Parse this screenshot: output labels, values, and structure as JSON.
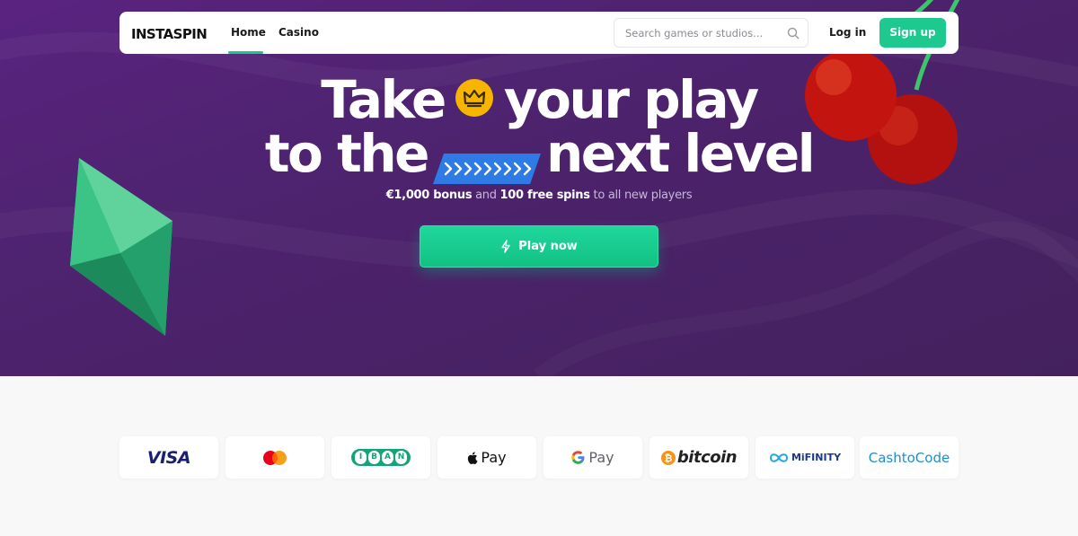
{
  "header": {
    "logo_text": "INSTASPIN",
    "nav": [
      {
        "label": "Home",
        "active": true
      },
      {
        "label": "Casino",
        "active": false
      }
    ],
    "search_placeholder": "Search games or studios...",
    "login_label": "Log in",
    "signup_label": "Sign up"
  },
  "hero": {
    "line1_word1": "Take",
    "line1_word2": "your play",
    "line2_word1": "to the",
    "line2_word2": "next level",
    "bonus_amount": "€1,000 bonus",
    "and_text": "and",
    "free_spins": "100 free spins",
    "to_players": "to all new players",
    "play_button_label": "Play now"
  },
  "payments": {
    "methods": [
      "VISA",
      "Mastercard",
      "IBAN",
      "Apple Pay",
      "Google Pay",
      "bitcoin",
      "MiFINITY",
      "CashtoCode"
    ],
    "visa_text": "VISA",
    "iban_letters": [
      "I",
      "B",
      "A",
      "N"
    ],
    "applepay_text": "Pay",
    "gpay_text": "Pay",
    "bitcoin_text": "bitcoin",
    "mifinity_text": "MiFINITY",
    "cashtocode_text": "CashtoCode"
  },
  "colors": {
    "hero_purple": "#4e2370",
    "accent_green": "#1ec98f",
    "crown_gold": "#f7b500",
    "arrow_blue": "#2f7be6"
  }
}
